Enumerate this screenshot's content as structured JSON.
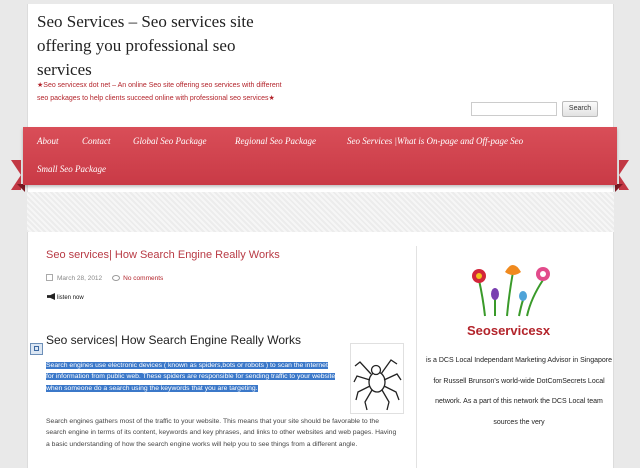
{
  "header": {
    "site_title": "Seo Services – Seo services site offering you professional seo services",
    "description": "Seo servicesx dot net – An online Seo site offering seo services with different seo packages to help clients succeed online with professional seo services"
  },
  "search": {
    "placeholder": "",
    "button_label": "Search"
  },
  "nav": {
    "items": [
      "About",
      "Contact",
      "Global Seo Package",
      "Regional Seo Package",
      "Seo Services |What is On-page and Off-page Seo",
      "Small Seo Package"
    ]
  },
  "post": {
    "title": "Seo services| How Search Engine Really Works",
    "date": "March 28, 2012",
    "comments": "No comments",
    "listen": "listen now",
    "heading": "Seo services|  How Search Engine Really Works",
    "highlighted_paragraph": "Search engines use electronic devices ( known as spiders,bots or robots ) to scan the internet for information from  public web. These spiders are responsible for sending traffic to your website when someone do a search  using the keywords that you are targeting.",
    "paragraph": "Search engines gathers most of the traffic to your website. This means that your site should be favorable to the search engine in terms of its content, keywords and key phrases, and links to other websites and web pages.  Having a basic understanding of how the search engine works will help you to see things from a different angle."
  },
  "sidebar": {
    "brand": "Seoservicesx",
    "text": "is a DCS Local Independant Marketing Advisor in Singapore for Russell Brunson's world-wide DotComSecrets Local network. As a part of this network the DCS Local team sources the very"
  },
  "colors": {
    "accent": "#c93a46",
    "link": "#b3242b",
    "highlight": "#3b78c9"
  }
}
